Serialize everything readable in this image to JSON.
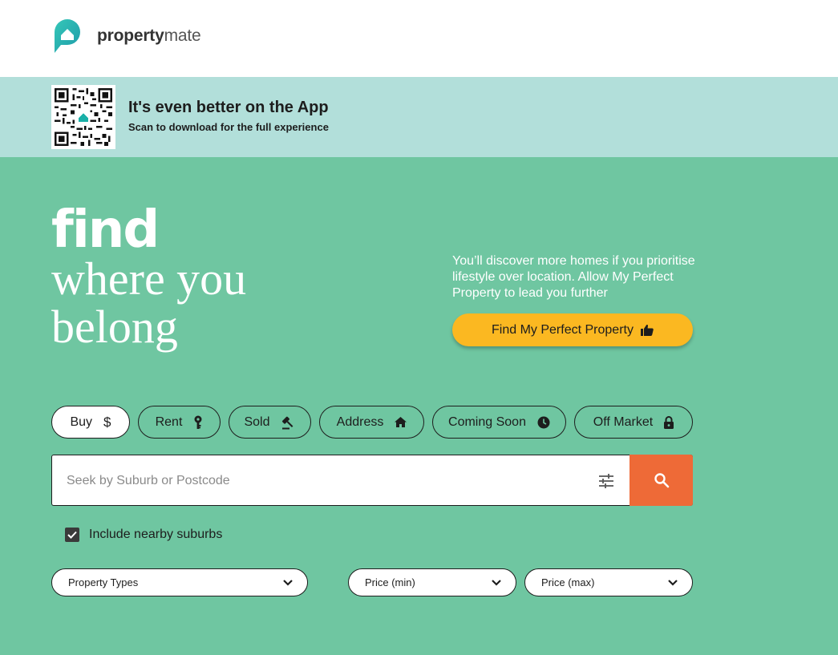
{
  "brand": {
    "name_bold": "property",
    "name_light": "mate",
    "accent": "#1ab0a8"
  },
  "app_banner": {
    "title": "It's even better on the App",
    "subtitle": "Scan to download for the full experience"
  },
  "hero": {
    "find": "find",
    "line1": "where you",
    "line2": "belong",
    "blurb": "You’ll discover more homes if you prioritise lifestyle over location. Allow My Perfect Property to lead you further",
    "cta_label": "Find My Perfect Property",
    "cta_icon": "thumbs-up-icon"
  },
  "categories": [
    {
      "label": "Buy",
      "icon": "dollar-icon",
      "active": true
    },
    {
      "label": "Rent",
      "icon": "key-icon",
      "active": false
    },
    {
      "label": "Sold",
      "icon": "gavel-icon",
      "active": false
    },
    {
      "label": "Address",
      "icon": "home-icon",
      "active": false
    },
    {
      "label": "Coming Soon",
      "icon": "clock-icon",
      "active": false
    },
    {
      "label": "Off Market",
      "icon": "lock-icon",
      "active": false
    }
  ],
  "search": {
    "placeholder": "Seek by Suburb or Postcode",
    "value": ""
  },
  "nearby": {
    "label": "Include nearby suburbs",
    "checked": true
  },
  "dropdowns": {
    "property_types": "Property Types",
    "price_min": "Price (min)",
    "price_max": "Price (max)"
  },
  "colors": {
    "background": "#6fc6a1",
    "banner": "#b2dfda",
    "cta": "#fbb821",
    "search_button": "#ee6a37"
  }
}
